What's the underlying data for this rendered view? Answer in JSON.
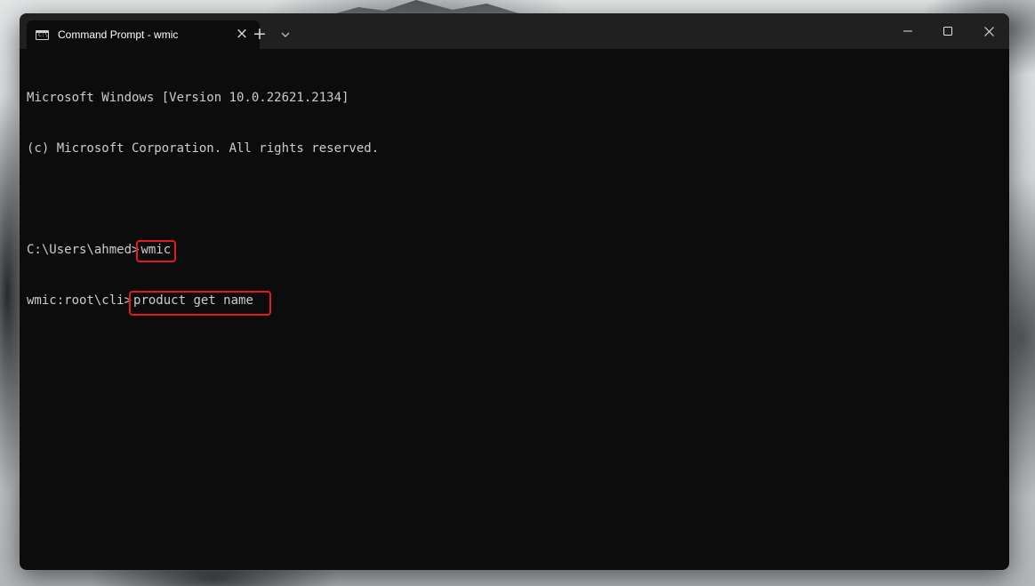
{
  "window": {
    "tab_title": "Command Prompt - wmic",
    "tab_icon": "cmd-icon",
    "tab_icon_glyph": "C:\\",
    "new_tab_label": "+",
    "close_tab_label": "×"
  },
  "console": {
    "banner_line1": "Microsoft Windows [Version 10.0.22621.2134]",
    "banner_line2": "(c) Microsoft Corporation. All rights reserved.",
    "prompt1": "C:\\Users\\ahmed>",
    "command1": "wmic",
    "prompt2": "wmic:root\\cli>",
    "command2": "product get name"
  },
  "colors": {
    "console_bg": "#0c0c0c",
    "titlebar_bg": "#202020",
    "text": "#cccccc",
    "highlight_box": "#e11b22"
  }
}
